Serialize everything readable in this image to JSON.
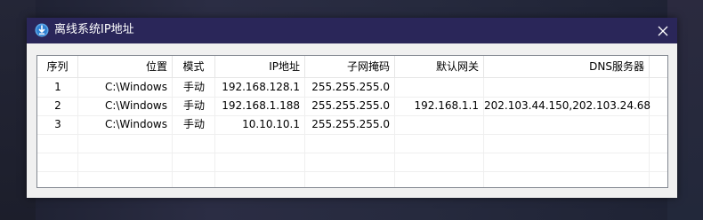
{
  "window": {
    "title": "离线系统IP地址",
    "icon": "app-icon",
    "close_icon": "close-icon"
  },
  "table": {
    "columns": [
      {
        "key": "index",
        "label": "序列"
      },
      {
        "key": "location",
        "label": "位置"
      },
      {
        "key": "mode",
        "label": "模式"
      },
      {
        "key": "ip",
        "label": "IP地址"
      },
      {
        "key": "mask",
        "label": "子网掩码"
      },
      {
        "key": "gateway",
        "label": "默认网关"
      },
      {
        "key": "dns",
        "label": "DNS服务器"
      }
    ],
    "rows": [
      {
        "index": "1",
        "location": "C:\\Windows",
        "mode": "手动",
        "ip": "192.168.128.1",
        "mask": "255.255.255.0",
        "gateway": "",
        "dns": ""
      },
      {
        "index": "2",
        "location": "C:\\Windows",
        "mode": "手动",
        "ip": "192.168.1.188",
        "mask": "255.255.255.0",
        "gateway": "192.168.1.1",
        "dns": "202.103.44.150,202.103.24.68"
      },
      {
        "index": "3",
        "location": "C:\\Windows",
        "mode": "手动",
        "ip": "10.10.10.1",
        "mask": "255.255.255.0",
        "gateway": "",
        "dns": ""
      }
    ]
  },
  "colors": {
    "titlebar": "#2a2659",
    "window_bg": "#f0f0f0",
    "list_bg": "#ffffff"
  }
}
